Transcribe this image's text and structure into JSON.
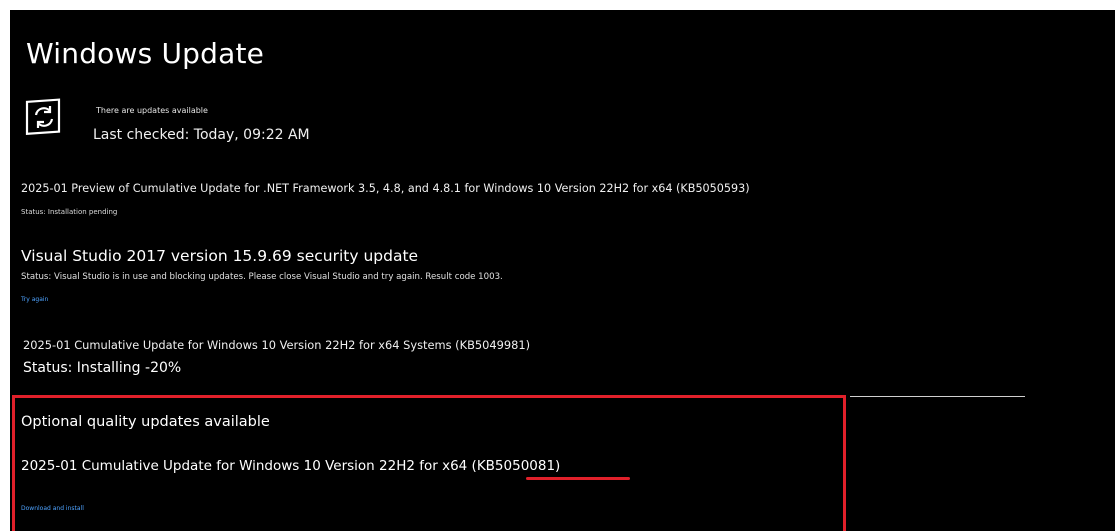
{
  "window": {
    "title": "Windows Update"
  },
  "status": {
    "icon": "sync-icon",
    "message": "There are updates available",
    "last_checked": "Last checked: Today, 09:22 AM"
  },
  "updates": [
    {
      "title": "2025-01 Preview of Cumulative Update for .NET Framework 3.5, 4.8, and 4.8.1 for Windows 10 Version 22H2 for x64 (KB5050593)",
      "status": "Status: Installation pending"
    },
    {
      "title": "Visual Studio 2017 version 15.9.69 security update",
      "status": "Status: Visual Studio is in use and blocking updates. Please close Visual Studio and try again. Result code 1003.",
      "action": "Try again"
    },
    {
      "title": "2025-01 Cumulative Update for Windows 10 Version 22H2 for x64 Systems (KB5049981)",
      "status": "Status: Installing -20%"
    }
  ],
  "optional": {
    "heading": "Optional quality updates available",
    "update_title": "2025-01 Cumulative Update for Windows 10 Version 22H2 for x64 (KB5050081)",
    "action": "Download and install"
  },
  "colors": {
    "background": "#000000",
    "text": "#ffffff",
    "link": "#4ea3ff",
    "highlight": "#e0202a"
  }
}
